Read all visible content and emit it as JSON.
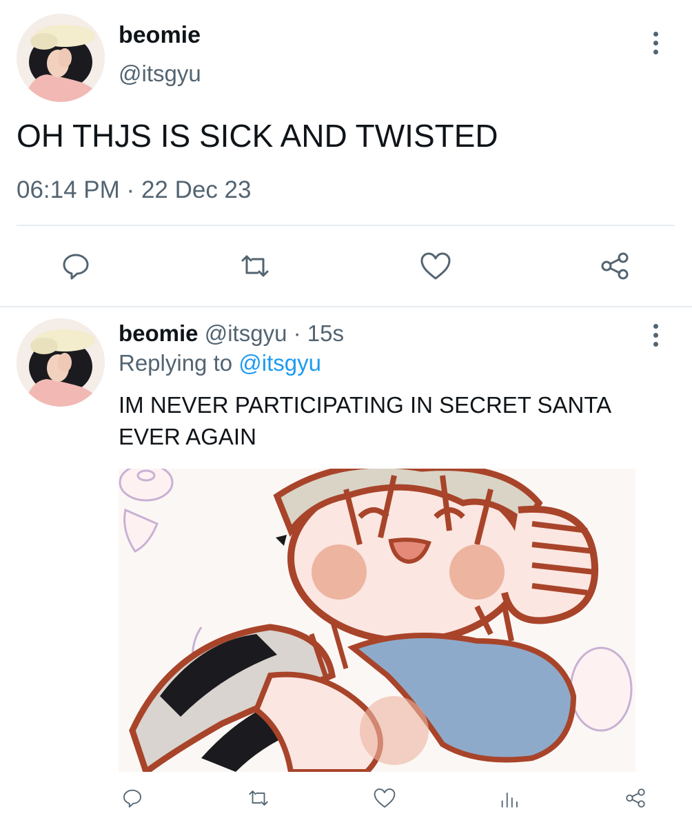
{
  "main_tweet": {
    "display_name": "beomie",
    "handle": "@itsgyu",
    "text": "OH THJS IS SICK AND TWISTED",
    "time": "06:14 PM",
    "separator": "·",
    "date": "22 Dec 23"
  },
  "reply_tweet": {
    "display_name": "beomie",
    "handle": "@itsgyu",
    "separator": "·",
    "age": "15s",
    "replying_prefix": "Replying to",
    "replying_handle": "@itsgyu",
    "text_line1": "IM NEVER PARTICIPATING IN SECRET SANTA",
    "text_line2": "EVER AGAIN"
  },
  "icons": [
    "reply-icon",
    "retweet-icon",
    "like-icon",
    "share-icon",
    "views-icon",
    "more-icon"
  ],
  "colors": {
    "text": "#0f1419",
    "muted": "#536471",
    "link": "#1d9bf0",
    "divider": "#e6ecf0"
  }
}
